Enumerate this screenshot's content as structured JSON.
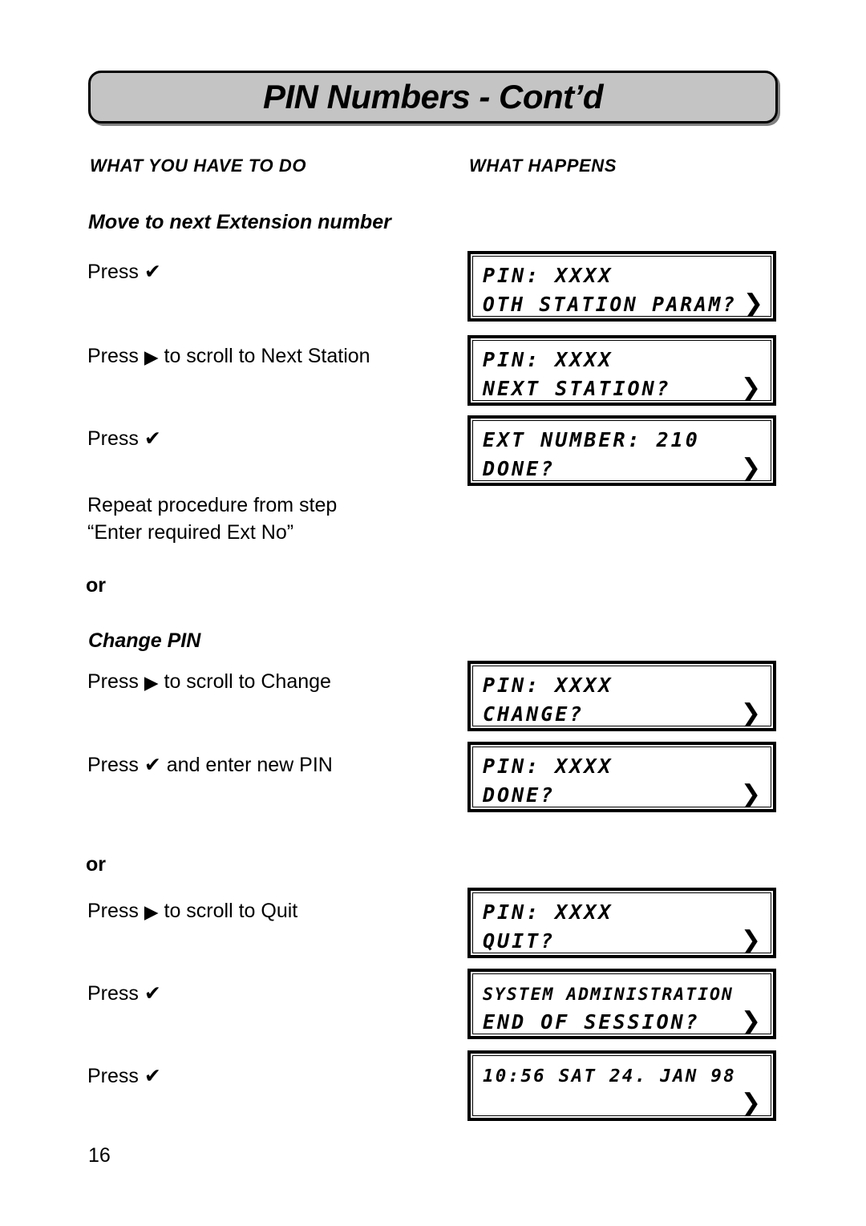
{
  "page": {
    "title": "PIN Numbers - Cont’d",
    "number": "16"
  },
  "columns": {
    "left_heading": "WHAT YOU HAVE TO DO",
    "right_heading": "WHAT HAPPENS"
  },
  "icons": {
    "check": "✔",
    "right_arrow": "▶",
    "chevron": "❯"
  },
  "sections": [
    {
      "id": "move-next-ext",
      "heading": "Move to next Extension number"
    },
    {
      "id": "change-pin",
      "heading": "Change PIN"
    }
  ],
  "or_labels": {
    "first": "or",
    "second": "or"
  },
  "steps": {
    "s1_press": "Press ",
    "s2_press": "Press ",
    "s2_rest": " to scroll to Next Station",
    "s3_press": "Press ",
    "s4_line1": "Repeat procedure from step",
    "s4_line2": "“Enter required Ext No”",
    "s5_press": "Press ",
    "s5_rest": " to scroll to Change",
    "s6_press": "Press ",
    "s6_rest": " and enter new PIN",
    "s7_press": "Press ",
    "s7_rest": " to scroll to Quit",
    "s8_press": "Press ",
    "s9_press": "Press "
  },
  "displays": [
    {
      "id": "d1",
      "line1": "PIN: XXXX",
      "line1_chevron": "",
      "line2": "OTH STATION PARAM?",
      "line2_chevron": "❯"
    },
    {
      "id": "d2",
      "line1": "PIN: XXXX",
      "line1_chevron": "",
      "line2": "NEXT STATION?",
      "line2_chevron": "❯"
    },
    {
      "id": "d3",
      "line1": "EXT NUMBER: 210",
      "line1_chevron": "",
      "line2": "DONE?",
      "line2_chevron": "❯"
    },
    {
      "id": "d4",
      "line1": "PIN: XXXX",
      "line1_chevron": "",
      "line2": "CHANGE?",
      "line2_chevron": "❯"
    },
    {
      "id": "d5",
      "line1": "PIN: XXXX",
      "line1_chevron": "",
      "line2": "DONE?",
      "line2_chevron": "❯"
    },
    {
      "id": "d6",
      "line1": "PIN: XXXX",
      "line1_chevron": "",
      "line2": "QUIT?",
      "line2_chevron": "❯"
    },
    {
      "id": "d7",
      "line1": "SYSTEM ADMINISTRATION",
      "line1_chevron": "",
      "line2": "END OF SESSION?",
      "line2_chevron": "❯"
    },
    {
      "id": "d8",
      "line1": "10:56 SAT 24. JAN 98",
      "line1_chevron": "",
      "line2": "",
      "line2_chevron": "❯"
    }
  ],
  "colors": {
    "banner_fill": "#c4c4c4",
    "banner_border": "#000000",
    "text": "#000000",
    "background": "#ffffff"
  }
}
